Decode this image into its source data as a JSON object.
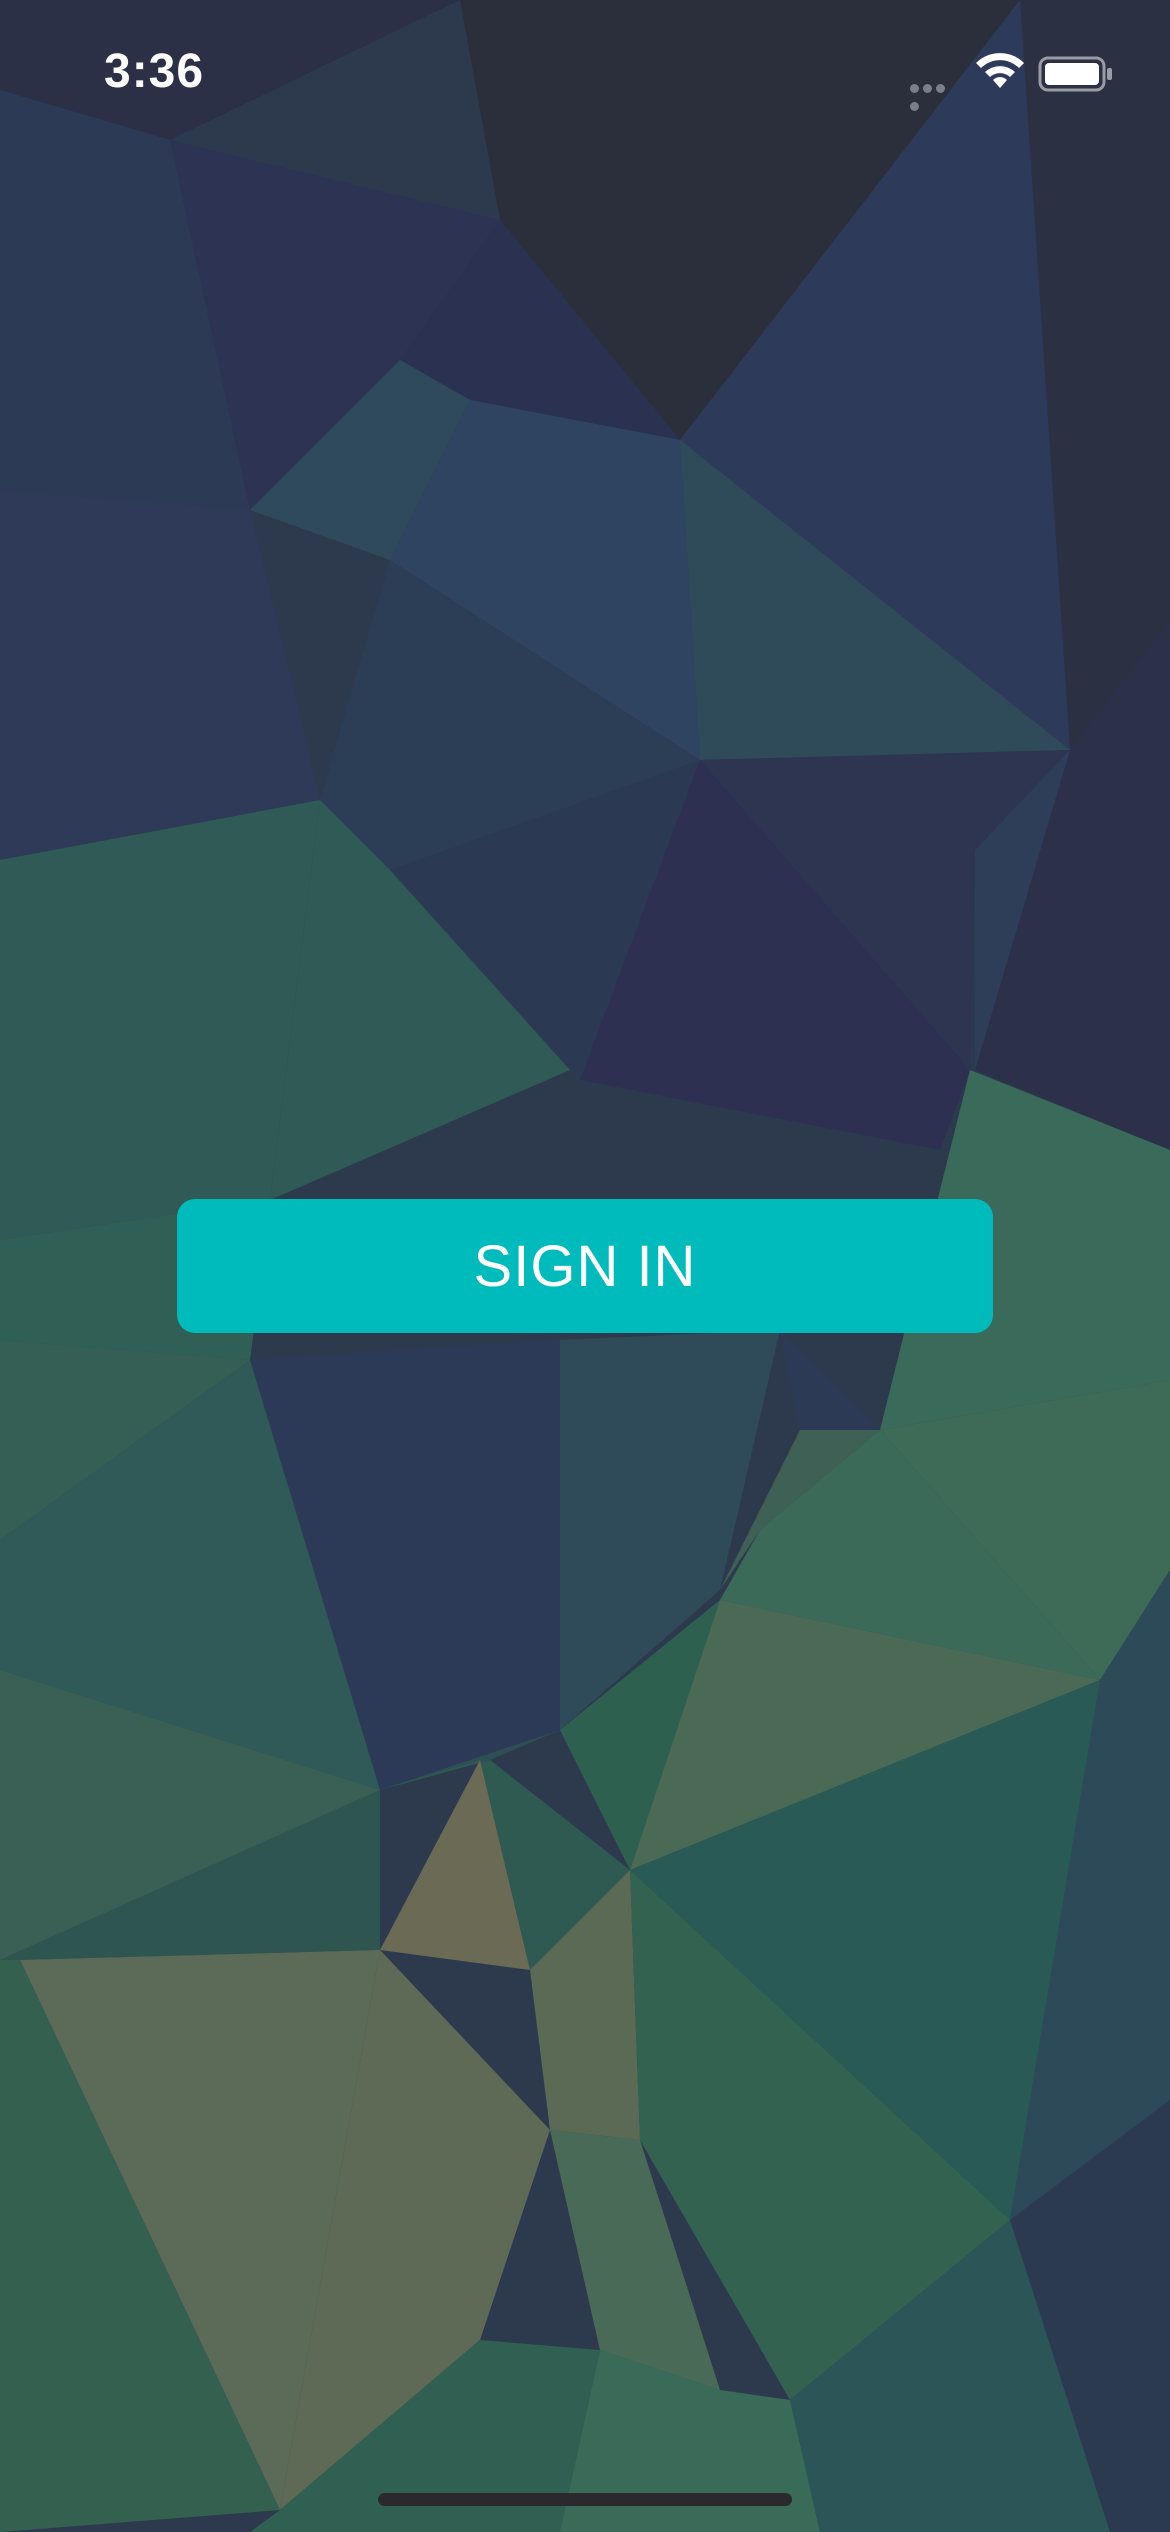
{
  "status_bar": {
    "time": "3:36",
    "signal_icon": "cellular-dots-icon",
    "wifi_icon": "wifi-icon",
    "battery_icon": "battery-icon",
    "battery_level": 1.0
  },
  "background": {
    "style": "low-poly triangle pattern",
    "colors": [
      "#2c3346",
      "#2c3a55",
      "#2e4a55",
      "#2f5a55",
      "#3a6a5a",
      "#5a6a55",
      "#6a6a50"
    ]
  },
  "main": {
    "sign_in_label": "SIGN IN",
    "button_color": "#00bbbc"
  },
  "home_indicator": {
    "icon": "home-indicator-bar"
  }
}
